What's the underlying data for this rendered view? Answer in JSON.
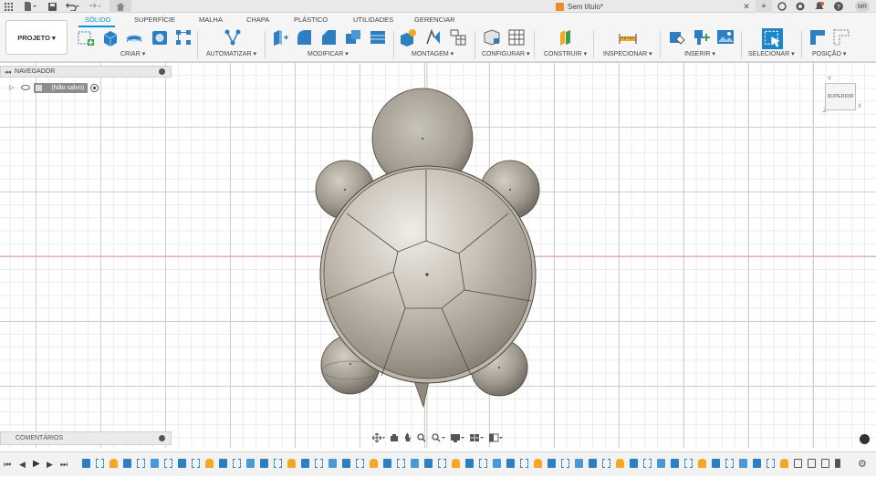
{
  "window": {
    "title": "Sem título*"
  },
  "user": {
    "initials": "MR"
  },
  "project_button": "PROJETO",
  "tabs": [
    "SÓLIDO",
    "SUPERFÍCIE",
    "MALHA",
    "CHAPA",
    "PLÁSTICO",
    "UTILIDADES",
    "GERENCIAR"
  ],
  "groups": [
    "CRIAR",
    "AUTOMATIZAR",
    "MODIFICAR",
    "MONTAGEM",
    "CONFIGURAR",
    "CONSTRUIR",
    "INSPECIONAR",
    "INSERIR",
    "SELECIONAR",
    "POSIÇÃO"
  ],
  "navigator": {
    "title": "NAVEGADOR",
    "root_label": "(Não salvo)"
  },
  "comments": {
    "title": "COMENTÁRIOS"
  },
  "viewcube": {
    "face": "SUPERIOR",
    "axis_x": "X",
    "axis_y": "Y",
    "axis_z": "Z"
  },
  "colors": {
    "accent": "#0696d7",
    "body": "#a09a8e"
  }
}
